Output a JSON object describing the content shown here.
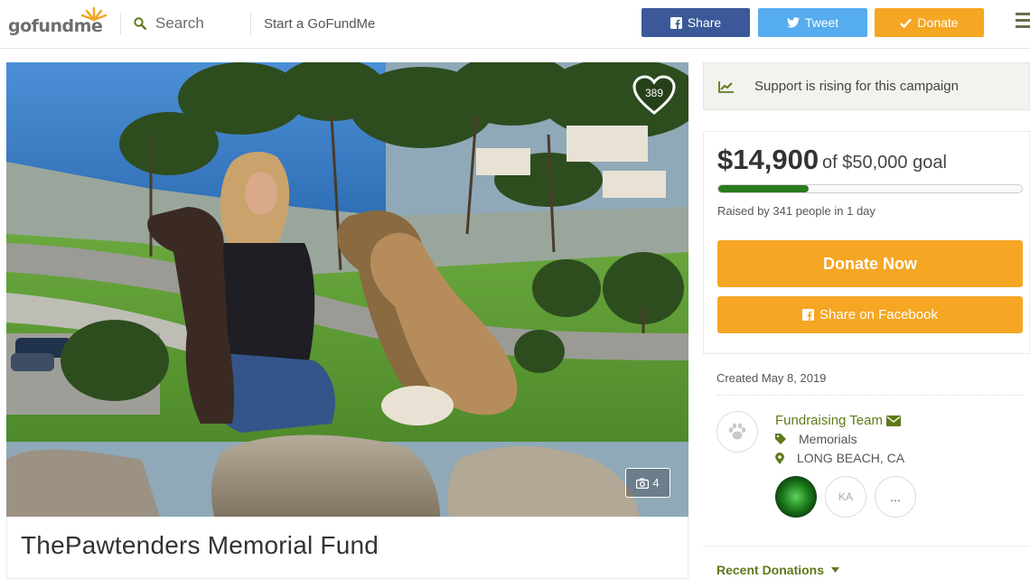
{
  "header": {
    "logo": "gofundme",
    "search_label": "Search",
    "start_label": "Start a GoFundMe",
    "share_label": "Share",
    "tweet_label": "Tweet",
    "donate_label": "Donate"
  },
  "campaign": {
    "title": "ThePawtenders Memorial Fund",
    "hearts": "389",
    "photo_count": "4"
  },
  "sidebar": {
    "rising_text": "Support is rising for this campaign",
    "raised_amount": "$14,900",
    "goal_text": "of $50,000 goal",
    "progress_fraction": 0.298,
    "raised_by": "Raised by 341 people in 1 day",
    "donate_now_label": "Donate Now",
    "share_facebook_label": "Share on Facebook",
    "created": "Created May 8, 2019",
    "team_label": "Fundraising Team",
    "category": "Memorials",
    "location": "LONG BEACH, CA",
    "member_initials": "KA",
    "more_label": "...",
    "recent_donations_label": "Recent Donations"
  },
  "colors": {
    "brand_green": "#5e7a1b",
    "donate_orange": "#f5a623",
    "facebook_blue": "#3b5998",
    "twitter_blue": "#55acee",
    "progress_green": "#2c7b1f"
  },
  "icons": [
    "search-icon",
    "facebook-icon",
    "twitter-icon",
    "check-icon",
    "menu-icon",
    "heart-icon",
    "camera-icon",
    "trend-icon",
    "paw-icon",
    "envelope-icon",
    "tag-icon",
    "map-pin-icon",
    "caret-down-icon"
  ]
}
